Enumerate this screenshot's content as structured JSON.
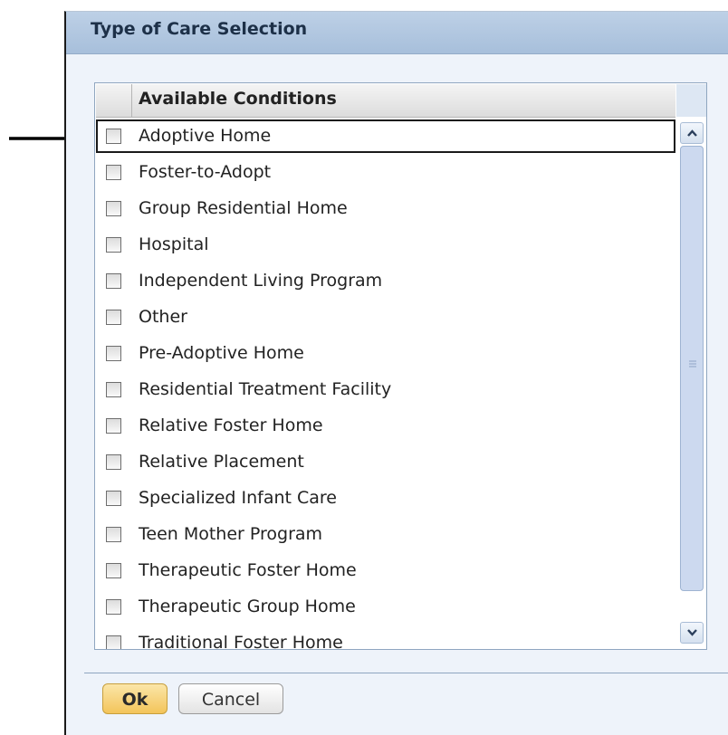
{
  "dialog": {
    "title": "Type of Care Selection"
  },
  "list": {
    "header": "Available Conditions",
    "items": [
      {
        "label": "Adoptive Home",
        "checked": false,
        "focused": true
      },
      {
        "label": "Foster-to-Adopt",
        "checked": false
      },
      {
        "label": "Group Residential Home",
        "checked": false
      },
      {
        "label": "Hospital",
        "checked": false
      },
      {
        "label": "Independent Living Program",
        "checked": false
      },
      {
        "label": "Other",
        "checked": false
      },
      {
        "label": "Pre-Adoptive Home",
        "checked": false
      },
      {
        "label": "Residential Treatment Facility",
        "checked": false
      },
      {
        "label": "Relative Foster Home",
        "checked": false
      },
      {
        "label": "Relative Placement",
        "checked": false
      },
      {
        "label": "Specialized Infant Care",
        "checked": false
      },
      {
        "label": "Teen Mother Program",
        "checked": false
      },
      {
        "label": "Therapeutic Foster Home",
        "checked": false
      },
      {
        "label": "Therapeutic Group Home",
        "checked": false
      },
      {
        "label": "Traditional Foster Home",
        "checked": false
      }
    ]
  },
  "buttons": {
    "ok": "Ok",
    "cancel": "Cancel"
  },
  "colors": {
    "titlebar": "#a7bfdb",
    "ok_button": "#f3c45a",
    "scroll_thumb": "#ccd9ef"
  },
  "icons": [
    "pointer-arrow-icon",
    "scroll-up-icon",
    "scroll-down-icon",
    "scroll-grip-icon"
  ]
}
